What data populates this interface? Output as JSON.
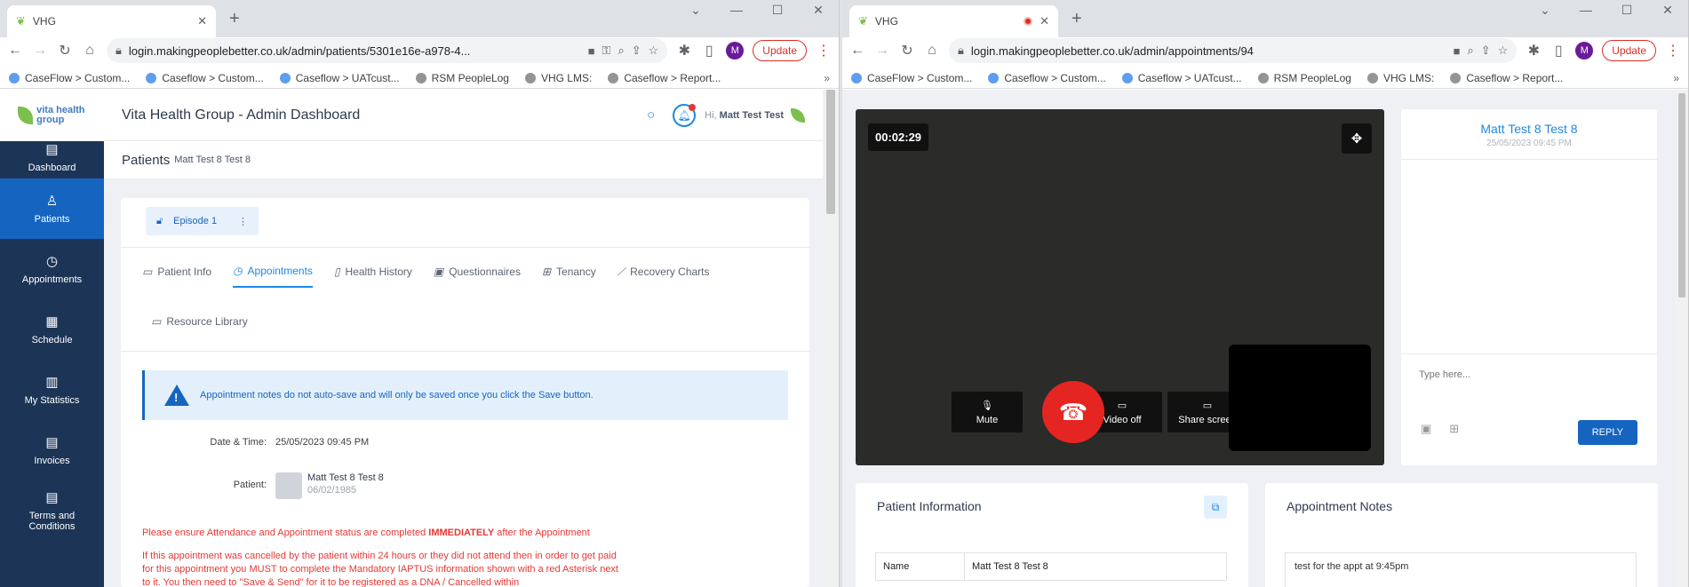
{
  "left": {
    "tab_title": "VHG",
    "url": "login.makingpeoplebetter.co.uk/admin/patients/5301e16e-a978-4...",
    "update_label": "Update",
    "avatar_letter": "M",
    "bookmarks": [
      "CaseFlow > Custom...",
      "Caseflow > Custom...",
      "Caseflow > UATcust...",
      "RSM PeopleLog",
      "VHG LMS:",
      "Caseflow > Report..."
    ],
    "app_title": "Vita Health Group - Admin Dashboard",
    "greeting_prefix": "Hi,",
    "greeting_name": "Matt Test Test",
    "logo_text": "vita health group",
    "sidebar": [
      {
        "label": "Dashboard",
        "icon": "dashboard-icon"
      },
      {
        "label": "Patients",
        "icon": "patient-icon",
        "active": true
      },
      {
        "label": "Appointments",
        "icon": "clock-icon"
      },
      {
        "label": "Schedule",
        "icon": "calendar-icon"
      },
      {
        "label": "My Statistics",
        "icon": "chart-icon"
      },
      {
        "label": "Invoices",
        "icon": "document-icon"
      },
      {
        "label": "Terms and Conditions",
        "icon": "document-icon"
      }
    ],
    "page_title": "Patients",
    "page_subtitle": "Matt Test 8 Test 8",
    "episode_label": "Episode 1",
    "tabs": [
      "Patient Info",
      "Appointments",
      "Health History",
      "Questionnaires",
      "Tenancy",
      "Recovery Charts"
    ],
    "tabs_row2": [
      "Resource Library"
    ],
    "alert_text": "Appointment notes do not auto-save and will only be saved once you click the Save button.",
    "datetime_label": "Date & Time:",
    "datetime_value": "25/05/2023 09:45 PM",
    "patient_label": "Patient:",
    "patient_name": "Matt Test 8 Test 8",
    "patient_dob": "06/02/1985",
    "warn1_pre": "Please ensure Attendance and Appointment status are completed ",
    "warn1_bold": "IMMEDIATELY",
    "warn1_post": " after the Appointment",
    "warn2": "If this appointment was cancelled by the patient within 24 hours or they did not attend then in order to get paid for this appointment you MUST to complete the Mandatory IAPTUS information shown with a red Asterisk next to it. You then need to \"Save & Send\" for it to be registered as a DNA / Cancelled within"
  },
  "right": {
    "tab_title": "VHG",
    "url": "login.makingpeoplebetter.co.uk/admin/appointments/94",
    "update_label": "Update",
    "avatar_letter": "M",
    "bookmarks": [
      "CaseFlow > Custom...",
      "Caseflow > Custom...",
      "Caseflow > UATcust...",
      "RSM PeopleLog",
      "VHG LMS:",
      "Caseflow > Report..."
    ],
    "timer": "00:02:29",
    "controls": {
      "mute": "Mute",
      "video_off": "Video off",
      "share_screen": "Share screen"
    },
    "chat_name": "Matt Test 8 Test 8",
    "chat_date": "25/05/2023 09:45 PM",
    "chat_placeholder": "Type here...",
    "reply_label": "REPLY",
    "patient_info_title": "Patient Information",
    "name_label": "Name",
    "name_value": "Matt Test 8 Test 8",
    "appointment_notes_title": "Appointment Notes",
    "notes_value": "test for the appt at 9:45pm"
  },
  "colors": {
    "primary": "#1565c0",
    "sidebar": "#1c3557",
    "danger": "#e52521",
    "accent": "#1e88e5"
  }
}
